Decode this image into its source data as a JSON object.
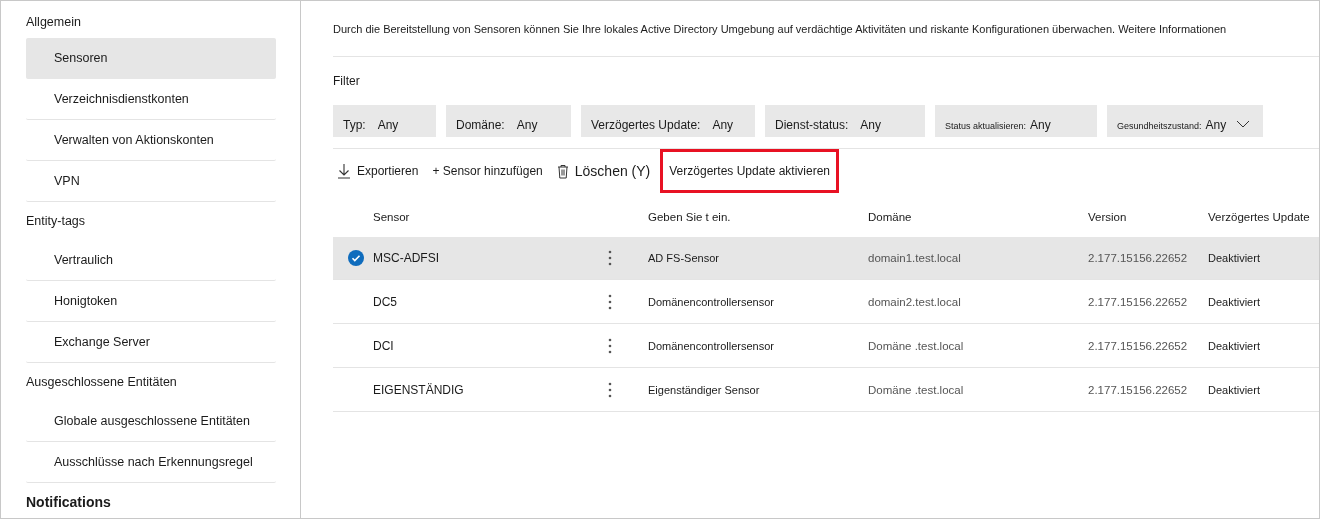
{
  "sidebar": {
    "groups": [
      {
        "title": "Allgemein",
        "kind": "group",
        "items": [
          {
            "label": "Sensoren",
            "selected": true
          },
          {
            "label": "Verzeichnisdienstkonten",
            "selected": false
          },
          {
            "label": "Verwalten von Aktionskonten",
            "selected": false
          },
          {
            "label": "VPN",
            "selected": false
          }
        ]
      },
      {
        "title": "Entity-tags",
        "kind": "group",
        "items": [
          {
            "label": "Vertraulich",
            "selected": false
          },
          {
            "label": "Honigtoken",
            "selected": false
          },
          {
            "label": "Exchange Server",
            "selected": false
          }
        ]
      },
      {
        "title": "Ausgeschlossene Entitäten",
        "kind": "group",
        "items": [
          {
            "label": "Globale ausgeschlossene Entitäten",
            "selected": false
          },
          {
            "label": "Ausschlüsse nach Erkennungsregel",
            "selected": false
          }
        ]
      },
      {
        "title": "Notifications",
        "kind": "section"
      }
    ]
  },
  "description": {
    "text": "Durch die Bereitstellung von Sensoren können Sie Ihre lokales Active Directory Umgebung auf verdächtige Aktivitäten und riskante Konfigurationen überwachen.",
    "link": "Weitere Informationen"
  },
  "filter": {
    "label": "Filter",
    "chips": [
      {
        "label": "Typ:",
        "value": "Any",
        "kind": "plain"
      },
      {
        "label": "Domäne:",
        "value": "Any",
        "kind": "plain"
      },
      {
        "label": "Verzögertes Update:",
        "value": "Any",
        "kind": "plain"
      },
      {
        "label": "Dienst-status:",
        "value": "Any",
        "kind": "plain"
      },
      {
        "label": "Status aktualisieren:",
        "value": "Any",
        "kind": "compact"
      },
      {
        "label": "Gesundheitszustand:",
        "value": "Any",
        "kind": "dropdown"
      }
    ]
  },
  "toolbar": [
    {
      "kind": "export",
      "label": "Exportieren",
      "highlighted": false
    },
    {
      "kind": "add",
      "label": "+ Sensor hinzufügen",
      "highlighted": false
    },
    {
      "kind": "delete",
      "label": "Löschen (Y)",
      "highlighted": false
    },
    {
      "kind": "plain",
      "label": "Verzögertes Update aktivieren",
      "highlighted": true
    }
  ],
  "table": {
    "columns": [
      "Sensor",
      "Geben Sie t ein.",
      "Domäne",
      "Version",
      "Verzögertes Update"
    ],
    "rows": [
      {
        "selected": true,
        "sensor": "MSC-ADFSI",
        "type": "AD FS-Sensor",
        "domain": "domain1.test.local",
        "version": "2.177.15156.22652",
        "delayed_update": "Deaktiviert"
      },
      {
        "selected": false,
        "sensor": "DC5",
        "type": "Domänencontrollersensor",
        "domain": "domain2.test.local",
        "version": "2.177.15156.22652",
        "delayed_update": "Deaktiviert"
      },
      {
        "selected": false,
        "sensor": "DCI",
        "type": "Domänencontrollersensor",
        "domain": "Domäne .test.local",
        "version": "2.177.15156.22652",
        "delayed_update": "Deaktiviert"
      },
      {
        "selected": false,
        "sensor": "EIGENSTÄNDIG",
        "type": "Eigenständiger Sensor",
        "domain": "Domäne .test.local",
        "version": "2.177.15156.22652",
        "delayed_update": "Deaktiviert"
      }
    ]
  }
}
